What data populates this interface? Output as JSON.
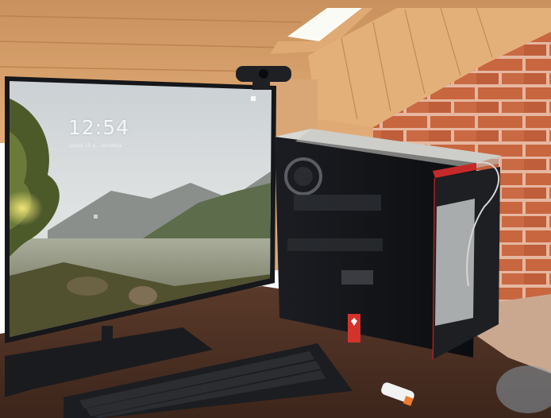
{
  "photo": {
    "subject": "desk-setup",
    "colors": {
      "wood_ceiling": "#d9a06a",
      "brick_wall": "#c4643f",
      "desk": "#4e3124",
      "monitor_bezel": "#15171a",
      "pc_case": "#101216",
      "pc_accent": "#c42a2a"
    }
  },
  "monitor": {
    "lock_screen": {
      "time": "12:54",
      "date": "среда 15 д... октобра"
    }
  },
  "pc_case": {
    "badge_icon": "brand-logo-icon"
  }
}
